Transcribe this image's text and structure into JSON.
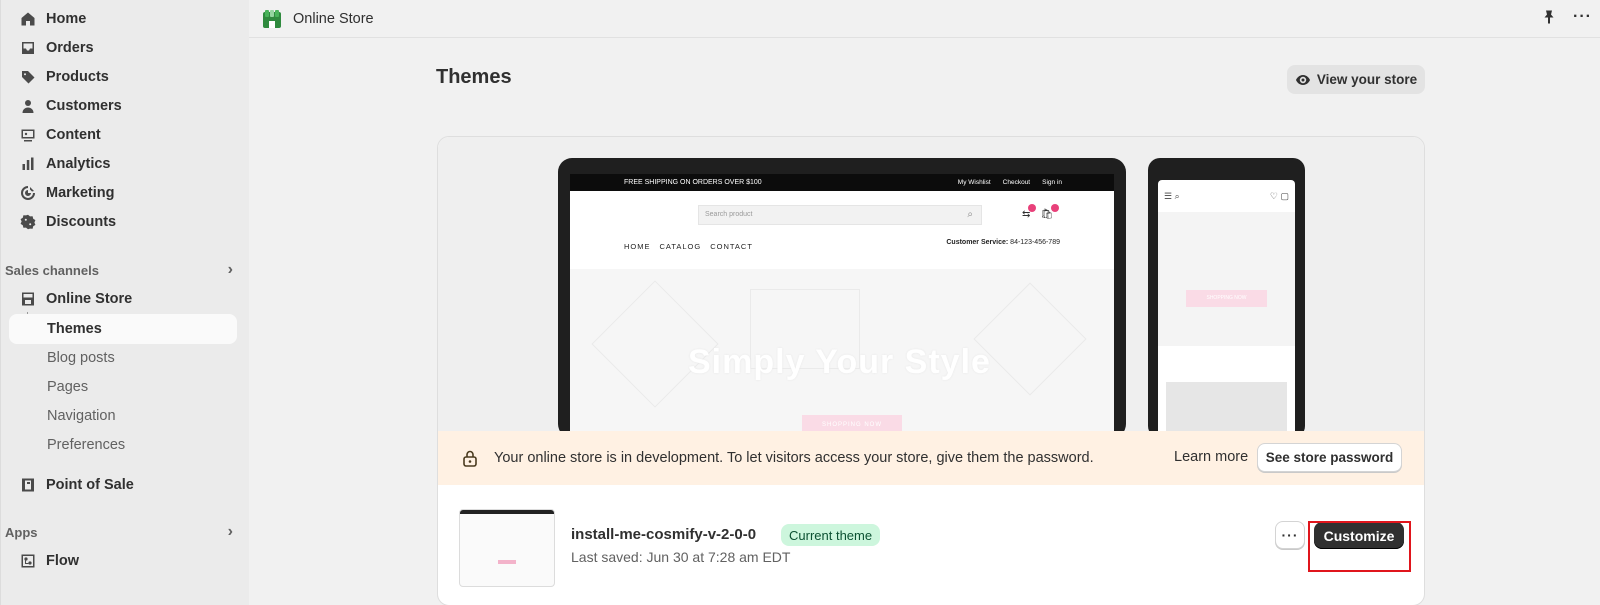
{
  "sidebar": {
    "main_items": [
      {
        "label": "Home",
        "icon": "home-icon"
      },
      {
        "label": "Orders",
        "icon": "orders-icon"
      },
      {
        "label": "Products",
        "icon": "tag-icon"
      },
      {
        "label": "Customers",
        "icon": "person-icon"
      },
      {
        "label": "Content",
        "icon": "content-icon"
      },
      {
        "label": "Analytics",
        "icon": "bar-chart-icon"
      },
      {
        "label": "Marketing",
        "icon": "target-icon"
      },
      {
        "label": "Discounts",
        "icon": "discount-icon"
      }
    ],
    "sales_channels_label": "Sales channels",
    "online_store_label": "Online Store",
    "sub_items": [
      {
        "label": "Themes",
        "active": true
      },
      {
        "label": "Blog posts"
      },
      {
        "label": "Pages"
      },
      {
        "label": "Navigation"
      },
      {
        "label": "Preferences"
      }
    ],
    "pos_label": "Point of Sale",
    "apps_label": "Apps",
    "flow_label": "Flow"
  },
  "topbar": {
    "title": "Online Store"
  },
  "main": {
    "page_title": "Themes",
    "view_store_label": "View your store"
  },
  "preview": {
    "laptop": {
      "top_strip": "FREE SHIPPING ON ORDERS OVER $100",
      "top_links": [
        "My Wishlist",
        "Checkout",
        "Sign in"
      ],
      "search_placeholder": "Search product",
      "nav": [
        "HOME",
        "CATALOG",
        "CONTACT"
      ],
      "service_label": "Customer Service:",
      "service_phone": "84-123-456-789",
      "hero_text": "Simply Your Style",
      "hero_button": "SHOPPING NOW"
    },
    "phone": {
      "hero_button": "SHOPPING NOW"
    }
  },
  "banner": {
    "message": "Your online store is in development. To let visitors access your store, give them the password.",
    "learn_more": "Learn more",
    "password_button": "See store password",
    "accent": "#fff1e3"
  },
  "theme": {
    "name": "install-me-cosmify-v-2-0-0",
    "badge": "Current theme",
    "last_saved": "Last saved: Jun 30 at 7:28 am EDT",
    "more_label": "···",
    "customize_label": "Customize"
  },
  "colors": {
    "highlight": "#e0151c",
    "badge_bg": "#cdf6dd",
    "primary_button": "#303030"
  }
}
